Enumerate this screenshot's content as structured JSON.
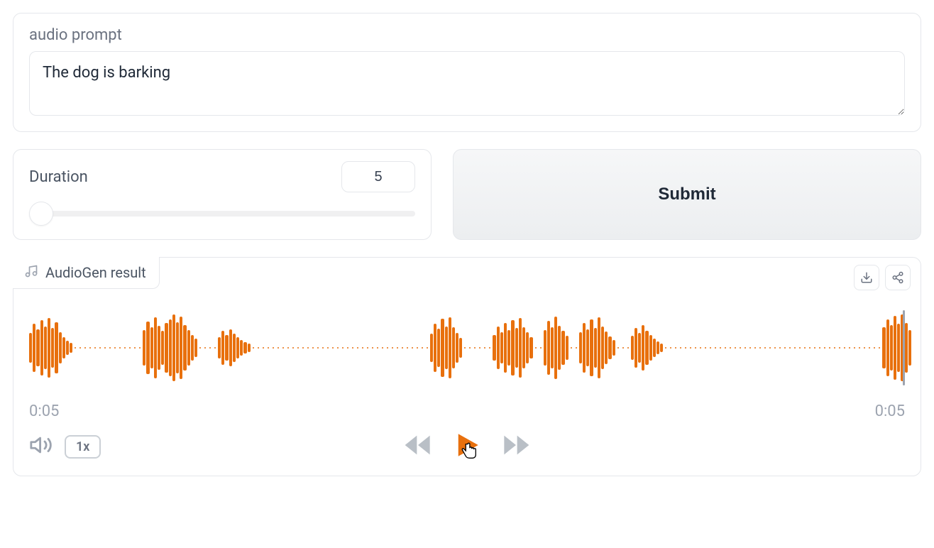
{
  "prompt": {
    "label": "audio prompt",
    "value": "The dog is barking"
  },
  "duration": {
    "label": "Duration",
    "value": "5"
  },
  "submit_label": "Submit",
  "result": {
    "tab_label": "AudioGen result",
    "time_current": "0:05",
    "time_total": "0:05",
    "speed_label": "1x"
  },
  "icons": {
    "music": "music-icon",
    "download": "download-icon",
    "share": "share-icon",
    "speaker": "speaker-icon",
    "rewind": "rewind-icon",
    "play": "play-icon",
    "forward": "forward-icon"
  },
  "colors": {
    "accent": "#e8700d",
    "border": "#e5e7eb",
    "muted_text": "#6b7280"
  },
  "waveform": {
    "groups": [
      {
        "type": "bars",
        "heights": [
          42,
          68,
          52,
          78,
          60,
          84,
          56,
          72,
          44,
          30,
          20,
          14
        ]
      },
      {
        "type": "dots",
        "count": 14
      },
      {
        "type": "bars",
        "heights": [
          50,
          74,
          58,
          86,
          62,
          48,
          70,
          80,
          94,
          72,
          88,
          64,
          50,
          36,
          26
        ]
      },
      {
        "type": "dots",
        "count": 4
      },
      {
        "type": "bars",
        "heights": [
          30,
          48,
          36,
          52,
          40,
          30,
          22,
          16,
          12
        ]
      },
      {
        "type": "dots",
        "count": 36
      },
      {
        "type": "bars",
        "heights": [
          40,
          68,
          54,
          82,
          60,
          86,
          58,
          42,
          28
        ]
      },
      {
        "type": "dots",
        "count": 6
      },
      {
        "type": "bars",
        "heights": [
          36,
          60,
          44,
          70,
          50,
          78,
          56,
          84,
          58,
          44,
          30
        ]
      },
      {
        "type": "dots",
        "count": 2
      },
      {
        "type": "bars",
        "heights": [
          50,
          76,
          58,
          88,
          62,
          48,
          34
        ]
      },
      {
        "type": "dots",
        "count": 2
      },
      {
        "type": "bars",
        "heights": [
          44,
          70,
          52,
          80,
          56,
          86,
          60,
          46,
          32,
          22
        ]
      },
      {
        "type": "dots",
        "count": 3
      },
      {
        "type": "bars",
        "heights": [
          34,
          56,
          42,
          64,
          48,
          36,
          26,
          18,
          12
        ]
      },
      {
        "type": "dots",
        "count": 44
      },
      {
        "type": "bars",
        "heights": [
          58,
          80,
          64,
          90,
          68,
          94,
          70,
          50
        ]
      }
    ]
  }
}
